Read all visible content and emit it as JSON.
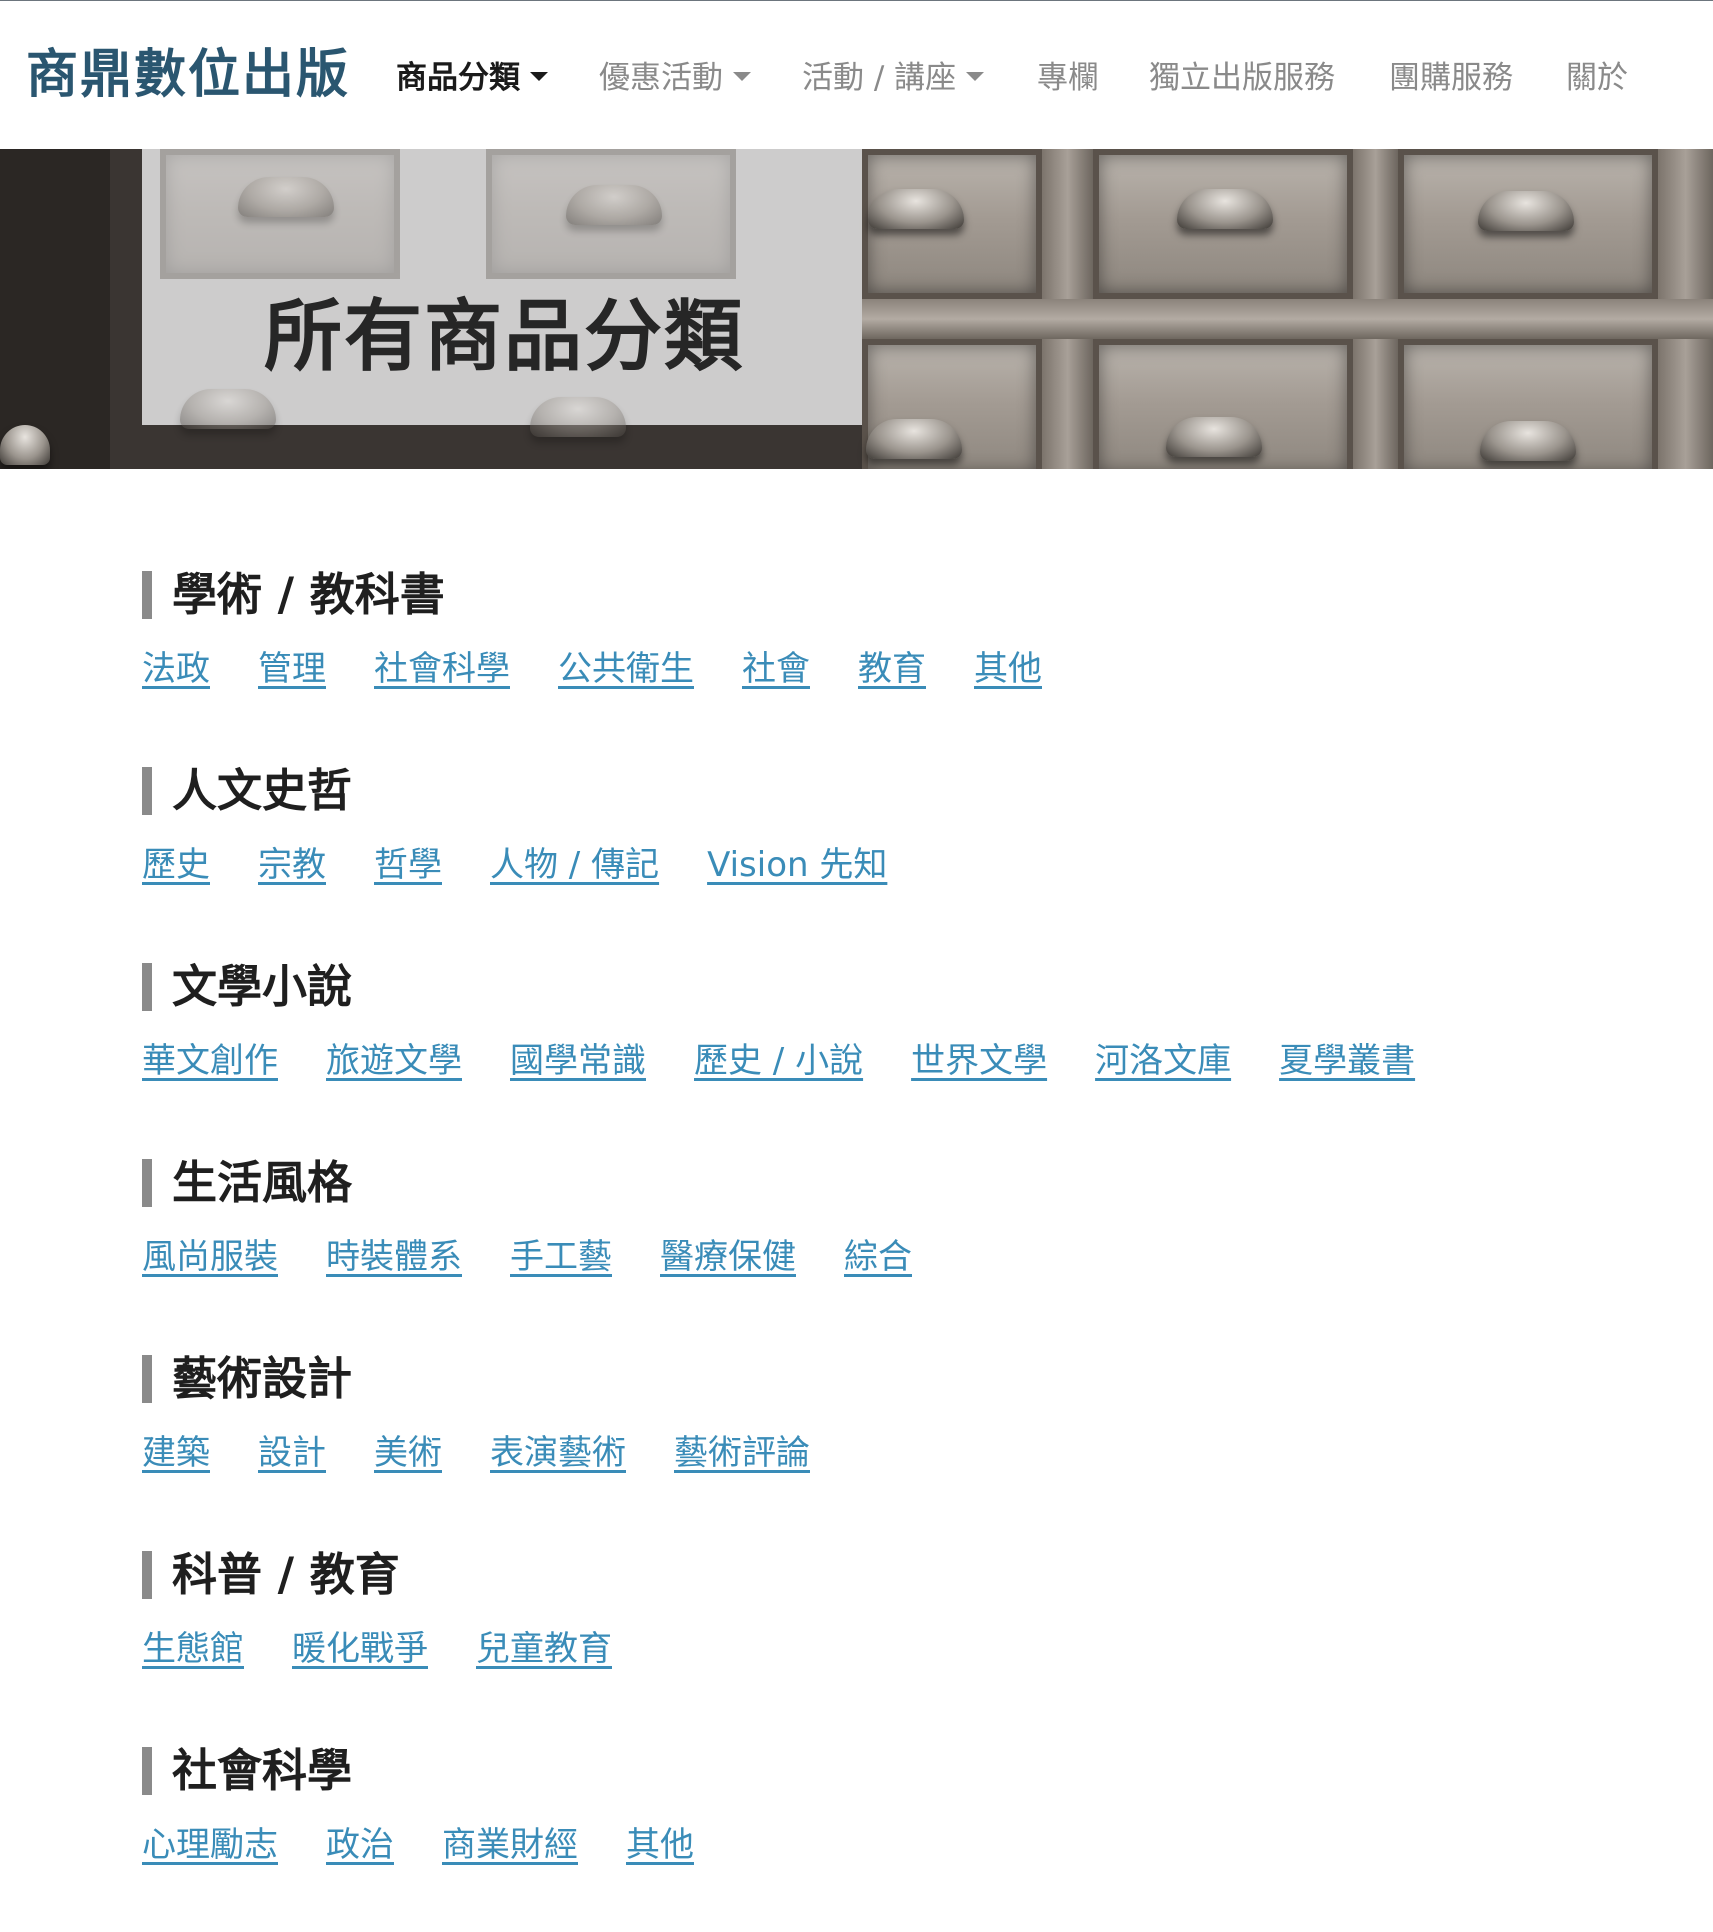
{
  "brand": {
    "name": "商鼎數位出版"
  },
  "nav": {
    "items": [
      {
        "label": "商品分類",
        "dropdown": true,
        "active": true
      },
      {
        "label": "優惠活動",
        "dropdown": true,
        "active": false
      },
      {
        "label": "活動 / 講座",
        "dropdown": true,
        "active": false
      },
      {
        "label": "專欄",
        "dropdown": false,
        "active": false
      },
      {
        "label": "獨立出版服務",
        "dropdown": false,
        "active": false
      },
      {
        "label": "團購服務",
        "dropdown": false,
        "active": false
      },
      {
        "label": "關於",
        "dropdown": false,
        "active": false
      }
    ]
  },
  "hero": {
    "title": "所有商品分類"
  },
  "colors": {
    "brand": "#2a5670",
    "link": "#3a8cb8",
    "section_bar": "#8a8a8a",
    "nav_inactive": "#8a8a8a",
    "nav_active": "#1a1a1a"
  },
  "sections": [
    {
      "title": "學術 / 教科書",
      "links": [
        "法政",
        "管理",
        "社會科學",
        "公共衛生",
        "社會",
        "教育",
        "其他"
      ]
    },
    {
      "title": "人文史哲",
      "links": [
        "歷史",
        "宗教",
        "哲學",
        "人物 / 傳記",
        "Vision 先知"
      ]
    },
    {
      "title": "文學小說",
      "links": [
        "華文創作",
        "旅遊文學",
        "國學常識",
        "歷史 / 小說",
        "世界文學",
        "河洛文庫",
        "夏學叢書"
      ]
    },
    {
      "title": "生活風格",
      "links": [
        "風尚服裝",
        "時裝體系",
        "手工藝",
        "醫療保健",
        "綜合"
      ]
    },
    {
      "title": "藝術設計",
      "links": [
        "建築",
        "設計",
        "美術",
        "表演藝術",
        "藝術評論"
      ]
    },
    {
      "title": "科普 / 教育",
      "links": [
        "生態館",
        "暖化戰爭",
        "兒童教育"
      ]
    },
    {
      "title": "社會科學",
      "links": [
        "心理勵志",
        "政治",
        "商業財經",
        "其他"
      ]
    }
  ]
}
